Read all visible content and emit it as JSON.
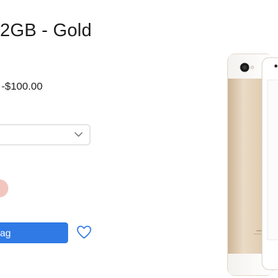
{
  "product": {
    "title": "2GB - Gold",
    "price": "-$100.00"
  },
  "selector": {
    "value": ""
  },
  "actions": {
    "add_to_bag_label": "ag"
  },
  "icons": {
    "dropdown": "chevron-down-icon",
    "favorite": "heart-icon"
  },
  "colors": {
    "button": "#2f7ae5",
    "swatch": "#f2c6bf",
    "phone_gold": "#e6d4bd"
  }
}
